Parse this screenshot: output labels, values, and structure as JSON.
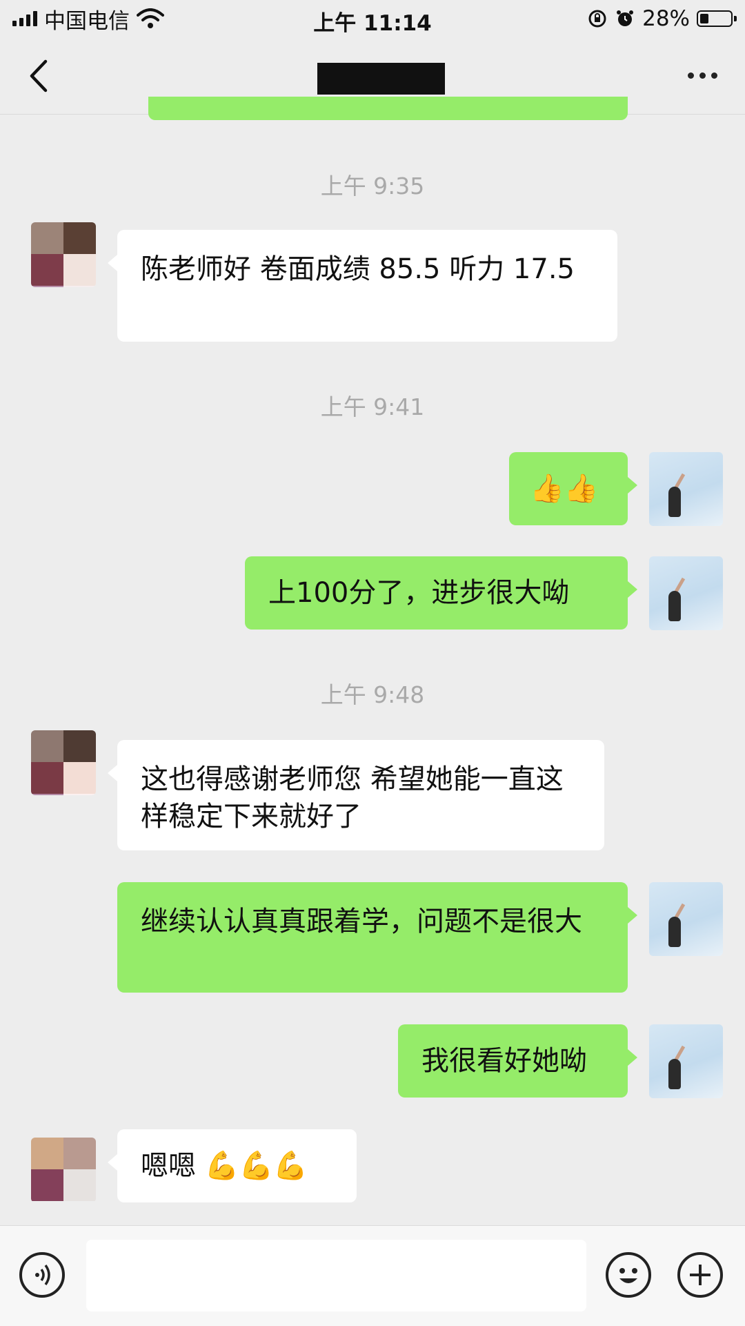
{
  "status_bar": {
    "carrier": "中国电信",
    "time": "上午 11:14",
    "battery": "28%",
    "battery_level": 0.28
  },
  "nav": {
    "title": ""
  },
  "messages": [
    {
      "kind": "time",
      "text": "上午 9:35"
    },
    {
      "kind": "in",
      "text": "陈老师好      卷面成绩 85.5 听力 17.5"
    },
    {
      "kind": "time",
      "text": "上午 9:41"
    },
    {
      "kind": "out",
      "text": "👍👍"
    },
    {
      "kind": "out",
      "text": "上100分了，进步很大呦"
    },
    {
      "kind": "time",
      "text": "上午 9:48"
    },
    {
      "kind": "in",
      "text": "这也得感谢老师您 希望她能一直这样稳定下来就好了"
    },
    {
      "kind": "out",
      "text": "继续认认真真跟着学，问题不是很大"
    },
    {
      "kind": "out",
      "text": "我很看好她呦"
    },
    {
      "kind": "in",
      "text": "嗯嗯 💪💪💪"
    }
  ],
  "input": {
    "value": "",
    "voice_icon": "voice-icon",
    "emoji_icon": "emoji-icon",
    "plus_icon": "plus-icon"
  },
  "colors": {
    "background": "#ededed",
    "out_bubble": "#95ec69",
    "in_bubble": "#ffffff",
    "timestamp": "#a9a9a9"
  }
}
